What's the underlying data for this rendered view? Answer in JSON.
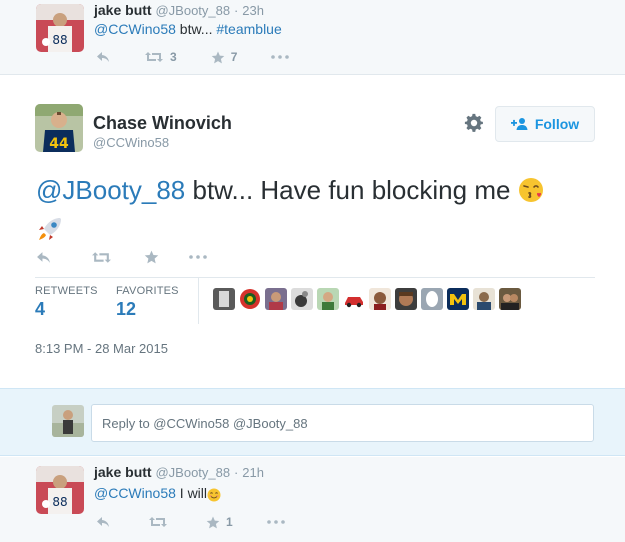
{
  "top_tweet": {
    "name": "jake butt",
    "handle": "@JBooty_88",
    "time": "23h",
    "mention": "@CCWino58",
    "text_mid": " btw... ",
    "hashtag": "#teamblue",
    "retweets": "3",
    "favorites": "7"
  },
  "main_tweet": {
    "name": "Chase Winovich",
    "handle": "@CCWino58",
    "follow_label": "Follow",
    "mention": "@JBooty_88",
    "text": " btw... Have fun blocking me ",
    "retweets_label": "RETWEETS",
    "retweets_count": "4",
    "favorites_label": "FAVORITES",
    "favorites_count": "12",
    "timestamp": "8:13 PM - 28 Mar 2015"
  },
  "reply": {
    "placeholder": "Reply to @CCWino58 @JBooty_88"
  },
  "bottom_tweet": {
    "name": "jake butt",
    "handle": "@JBooty_88",
    "time": "21h",
    "mention": "@CCWino58",
    "text": " I will",
    "favorites": "1"
  },
  "colors": {
    "link": "#2b7bb9",
    "follow": "#1b95e0",
    "icon": "#aab8c2"
  }
}
